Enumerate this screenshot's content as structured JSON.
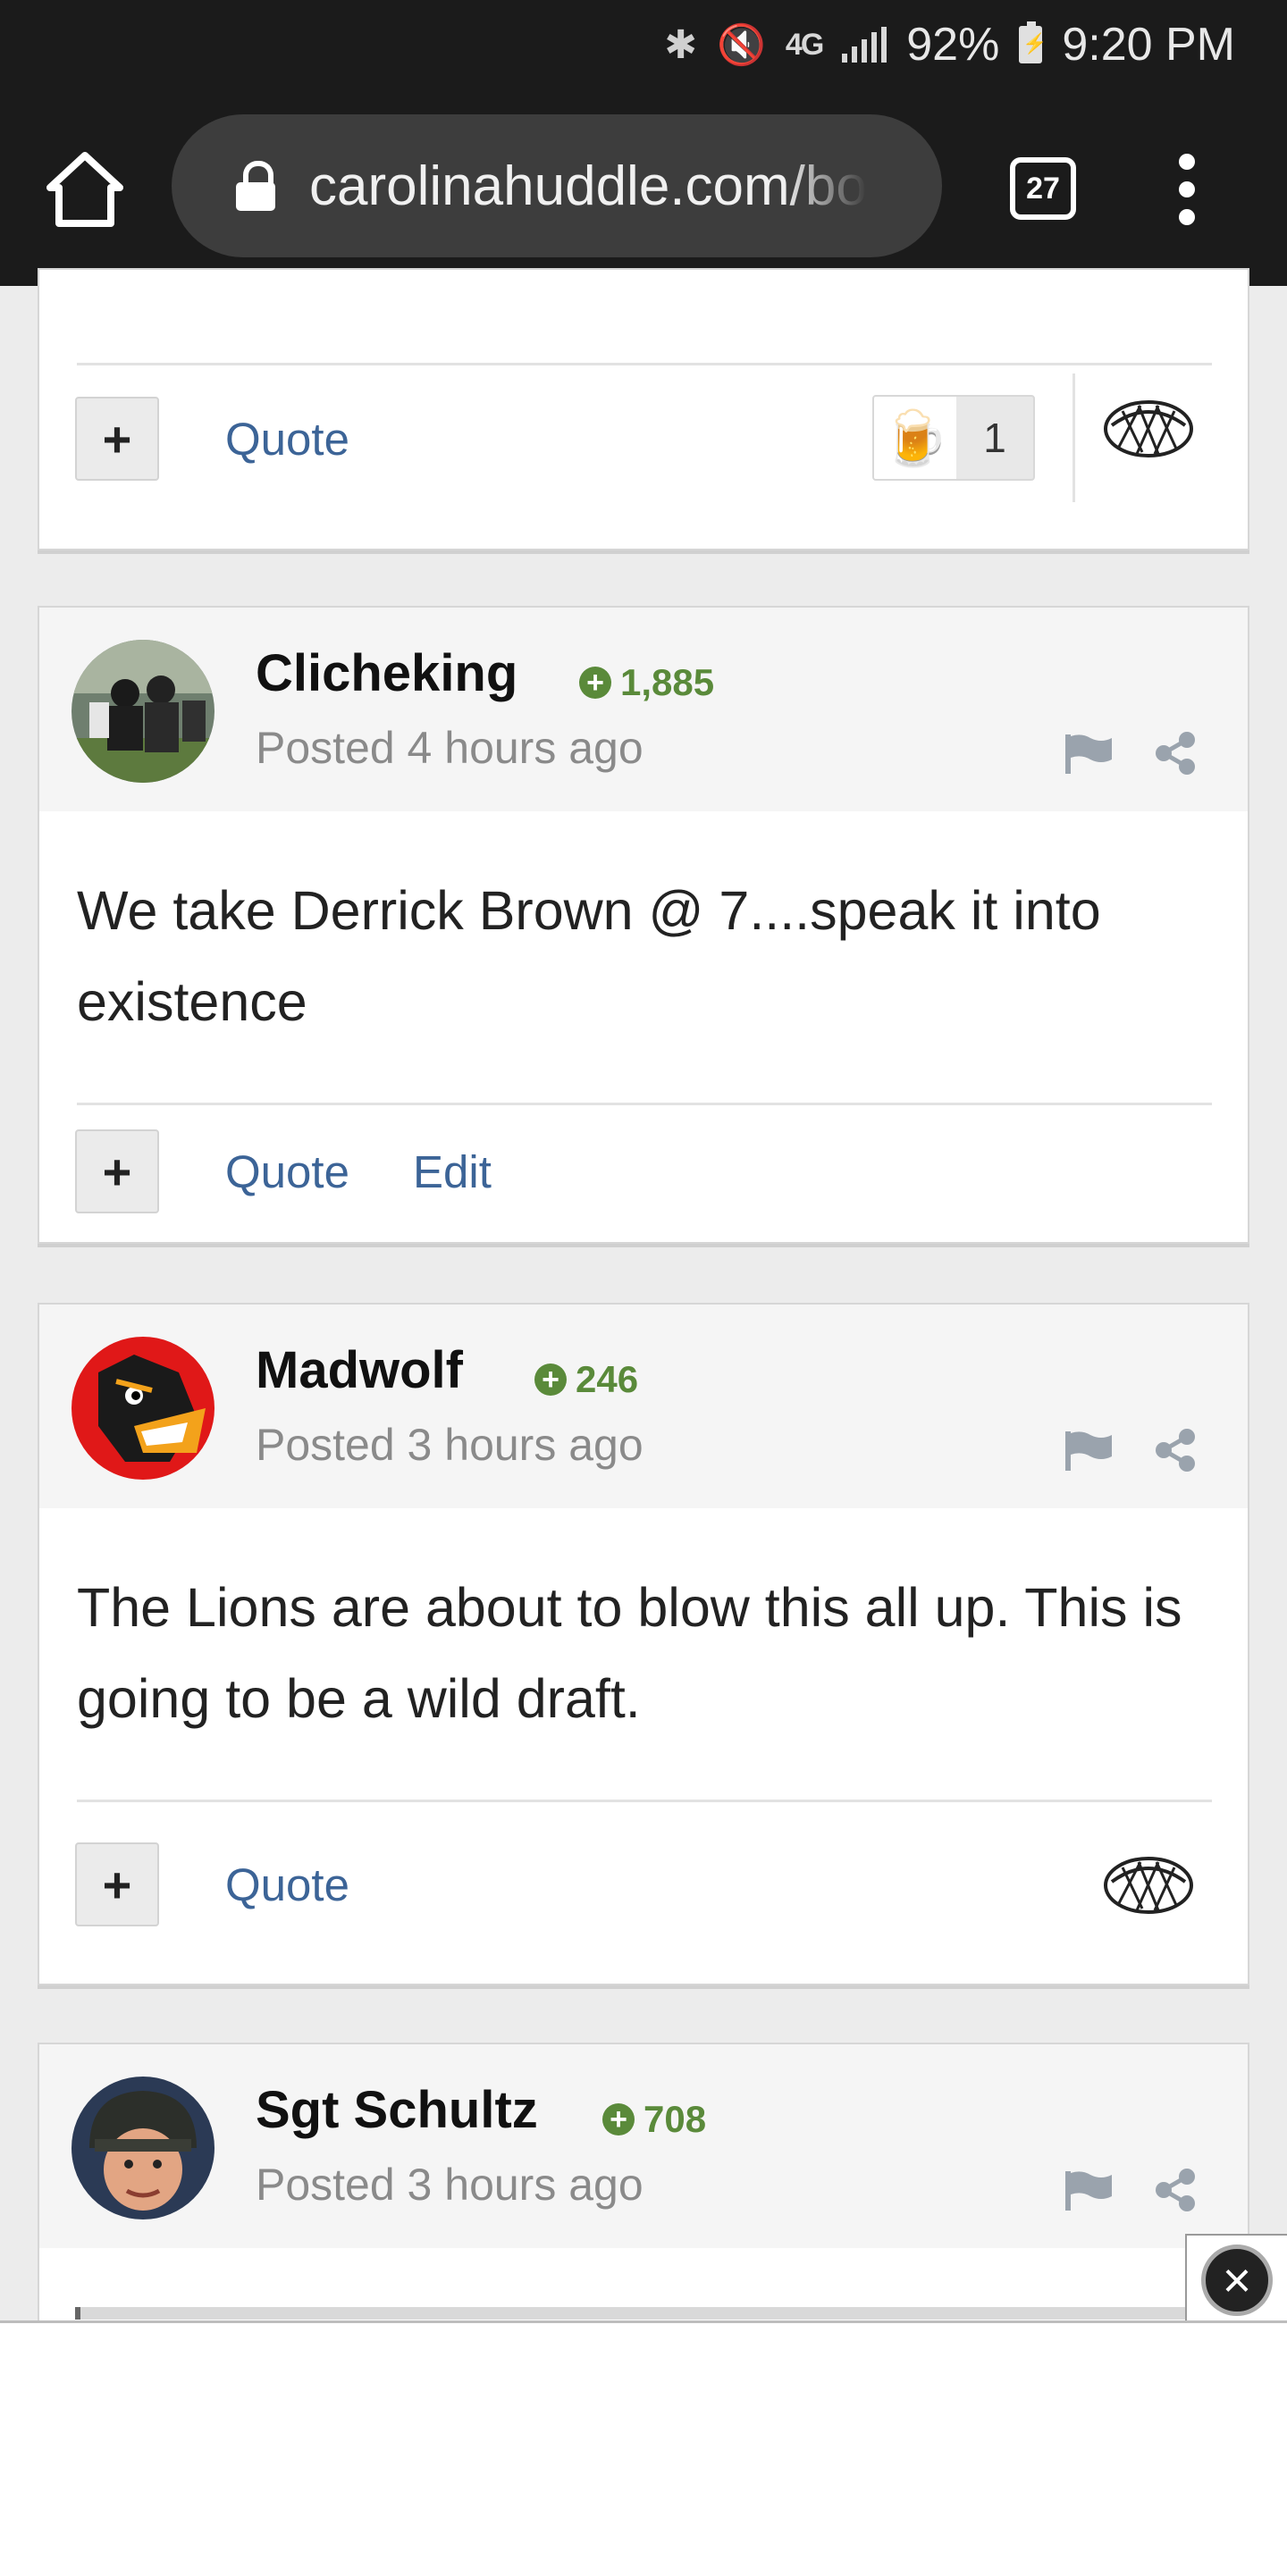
{
  "status_bar": {
    "network": "4G",
    "battery": "92%",
    "time": "9:20 PM"
  },
  "browser": {
    "url": "carolinahuddle.com/bo",
    "tab_count": "27"
  },
  "top_card": {
    "plus_label": "+",
    "quote_label": "Quote",
    "beer_count": "1"
  },
  "posts": [
    {
      "author": "Clicheking",
      "reputation": "1,885",
      "posted": "Posted 4 hours ago",
      "body": "We take Derrick Brown @ 7....speak it into existence",
      "plus_label": "+",
      "quote_label": "Quote",
      "edit_label": "Edit"
    },
    {
      "author": "Madwolf",
      "reputation": "246",
      "posted": "Posted 3 hours ago",
      "body": "The Lions are about to blow this all up. This is going to be a wild draft.",
      "plus_label": "+",
      "quote_label": "Quote"
    },
    {
      "author": "Sgt Schultz",
      "reputation": "708",
      "posted": "Posted 3 hours ago"
    }
  ],
  "colors": {
    "link": "#3c6497",
    "reputation": "#5a8a3a",
    "header_bg": "#f5f5f5"
  },
  "icons": [
    "home-icon",
    "lock-icon",
    "tabs-icon",
    "menu-icon",
    "flag-icon",
    "share-icon",
    "pie-icon",
    "beer-icon",
    "close-icon"
  ]
}
